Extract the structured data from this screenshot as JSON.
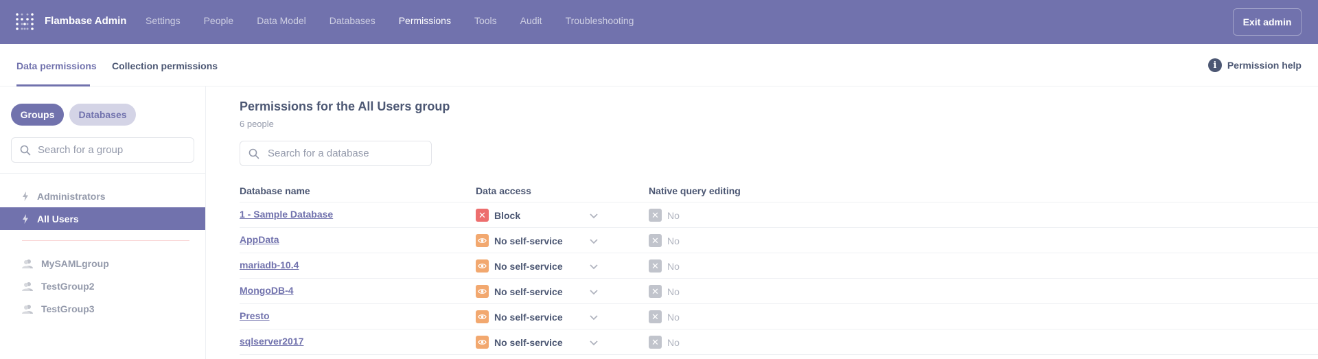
{
  "nav": {
    "brand": "Flambase Admin",
    "links": [
      "Settings",
      "People",
      "Data Model",
      "Databases",
      "Permissions",
      "Tools",
      "Audit",
      "Troubleshooting"
    ],
    "active": "Permissions",
    "exit_label": "Exit admin",
    "bg_color": "#7172ad"
  },
  "tabs": {
    "data": "Data permissions",
    "collection": "Collection permissions",
    "help": "Permission help"
  },
  "sidebar": {
    "toggle_groups": "Groups",
    "toggle_databases": "Databases",
    "search_placeholder": "Search for a group",
    "groups": [
      {
        "label": "Administrators",
        "icon": "bolt-icon",
        "active": false
      },
      {
        "label": "All Users",
        "icon": "bolt-icon",
        "active": true
      },
      {
        "label": "MySAMLgroup",
        "icon": "users-icon",
        "active": false
      },
      {
        "label": "TestGroup2",
        "icon": "users-icon",
        "active": false
      },
      {
        "label": "TestGroup3",
        "icon": "users-icon",
        "active": false
      }
    ]
  },
  "main": {
    "title": "Permissions for the All Users group",
    "subtitle": "6 people",
    "search_placeholder": "Search for a database",
    "columns": [
      "Database name",
      "Data access",
      "Native query editing"
    ],
    "rows": [
      {
        "name": "1 - Sample Database",
        "access": "Block",
        "access_icon": "block-icon",
        "native": "No"
      },
      {
        "name": "AppData",
        "access": "No self-service",
        "access_icon": "eye-icon",
        "native": "No"
      },
      {
        "name": "mariadb-10.4",
        "access": "No self-service",
        "access_icon": "eye-icon",
        "native": "No"
      },
      {
        "name": "MongoDB-4",
        "access": "No self-service",
        "access_icon": "eye-icon",
        "native": "No"
      },
      {
        "name": "Presto",
        "access": "No self-service",
        "access_icon": "eye-icon",
        "native": "No"
      },
      {
        "name": "sqlserver2017",
        "access": "No self-service",
        "access_icon": "eye-icon",
        "native": "No"
      }
    ]
  }
}
